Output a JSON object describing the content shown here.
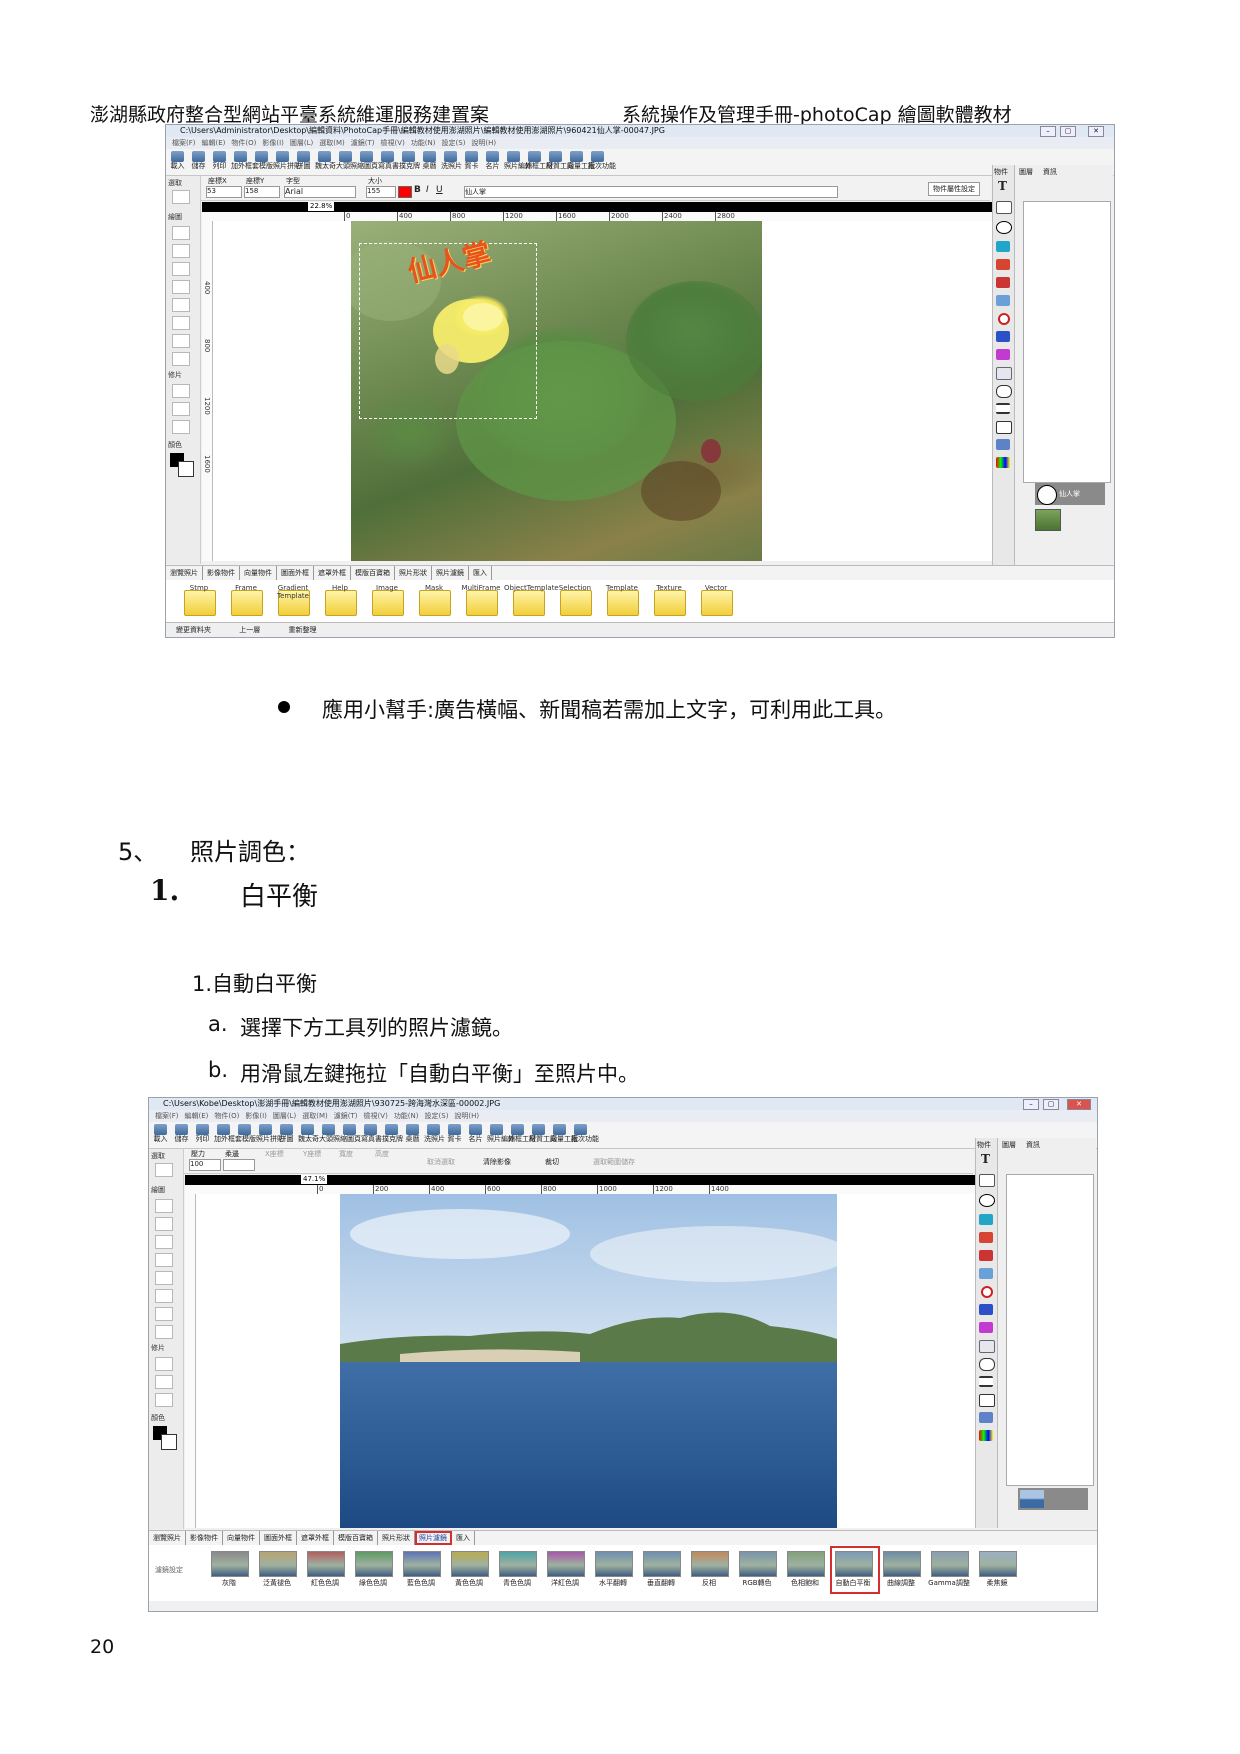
{
  "header": {
    "left": "澎湖縣政府整合型網站平臺系統維運服務建置案",
    "right": "系統操作及管理手冊-photoCap 繪圖軟體教材"
  },
  "screenshot1": {
    "title": "C:\\Users\\Administrator\\Desktop\\編輯資料\\PhotoCap手冊\\編輯教材使用澎湖照片\\編輯教材使用澎湖照片\\960421仙人掌-00047.JPG",
    "menu": [
      "檔案(F)",
      "編輯(E)",
      "物件(O)",
      "影像(I)",
      "圖層(L)",
      "選取(M)",
      "濾鏡(T)",
      "檢視(V)",
      "功能(N)",
      "設定(S)",
      "說明(H)"
    ],
    "toolbar": [
      "載入",
      "儲存",
      "列印",
      "加外框",
      "套模版",
      "照片拼貼",
      "拼圖",
      "魏太奇",
      "大頭照",
      "縮圖頁",
      "寫真書",
      "撲克牌",
      "桌曆",
      "洗照片",
      "賀卡",
      "名片",
      "照片編輯",
      "外框工廠",
      "材質工廠",
      "向量工廠",
      "批次功能"
    ],
    "props": {
      "x_label": "座標X",
      "y_label": "座標Y",
      "font_label": "字型",
      "size_label": "大小",
      "x_val": "53",
      "y_val": "158",
      "font_val": "Arial",
      "size_val": "155",
      "text_val": "仙人掌",
      "obj_btn": "物件屬性設定"
    },
    "left_labels": [
      "選取",
      "繪圖",
      "修片",
      "顏色"
    ],
    "zoom": "22.8%",
    "ruler_ticks": [
      "0",
      "400",
      "800",
      "1200",
      "1600",
      "2000",
      "2400",
      "2800"
    ],
    "vruler_ticks": [
      "400",
      "800",
      "1200",
      "1600"
    ],
    "photo_text": "仙人掌",
    "right_tabs": [
      "物件",
      "圖層",
      "資訊"
    ],
    "layer_label": "仙人掌",
    "bottom_tabs": [
      "瀏覽照片",
      "影像物件",
      "向量物件",
      "圖面外框",
      "遮罩外框",
      "模版百寶箱",
      "照片形狀",
      "照片濾鏡",
      "匯入"
    ],
    "folders": [
      "Stmp",
      "Frame",
      "Gradient Template",
      "Help",
      "Image",
      "Mask",
      "MultiFrame",
      "ObjectTemplate",
      "Selection",
      "Template",
      "Texture",
      "Vector"
    ],
    "status": [
      "變更資料夾",
      "上一層",
      "重新整理"
    ]
  },
  "bullet": "應用小幫手:廣告橫幅、新聞稿若需加上文字，可利用此工具。",
  "section": {
    "num": "5、",
    "title": "照片調色："
  },
  "subsection": {
    "num": "1.",
    "title": "白平衡"
  },
  "item": "1.自動白平衡",
  "steps": [
    {
      "label": "a.",
      "text": "選擇下方工具列的照片濾鏡。"
    },
    {
      "label": "b.",
      "text": "用滑鼠左鍵拖拉「自動白平衡」至照片中。"
    }
  ],
  "screenshot2": {
    "title": "C:\\Users\\Kobe\\Desktop\\澎湖手冊\\編輯教材使用澎湖照片\\930725-跨海灣水深區-00002.JPG",
    "menu": [
      "檔案(F)",
      "編輯(E)",
      "物件(O)",
      "影像(I)",
      "圖層(L)",
      "選取(M)",
      "濾鏡(T)",
      "檢視(V)",
      "功能(N)",
      "設定(S)",
      "說明(H)"
    ],
    "toolbar": [
      "載入",
      "儲存",
      "列印",
      "加外框",
      "套模版",
      "照片拼貼",
      "拼圖",
      "魏太奇",
      "大頭照",
      "縮圖頁",
      "寫真書",
      "撲克牌",
      "桌曆",
      "洗照片",
      "賀卡",
      "名片",
      "照片編輯",
      "外框工廠",
      "材質工廠",
      "向量工廠",
      "批次功能"
    ],
    "props": {
      "a": "壓力",
      "b": "柔邊",
      "c": "X座標",
      "d": "Y座標",
      "e": "寬度",
      "f": "高度",
      "v1": "100",
      "cancel": "取消選取",
      "clear": "清除影像",
      "crop": "裁切",
      "save_sel": "選取範圍儲存"
    },
    "left_labels": [
      "選取",
      "繪圖",
      "修片",
      "顏色"
    ],
    "zoom": "47.1%",
    "ruler_ticks": [
      "0",
      "200",
      "400",
      "600",
      "800",
      "1000",
      "1200",
      "1400"
    ],
    "right_tabs": [
      "物件",
      "圖層",
      "資訊"
    ],
    "bottom_tabs": [
      "瀏覽照片",
      "影像物件",
      "向量物件",
      "圖面外框",
      "遮罩外框",
      "模版百寶箱",
      "照片形狀",
      "照片濾鏡",
      "匯入"
    ],
    "active_tab": "照片濾鏡",
    "filter_btn": "濾鏡設定",
    "filters": [
      "灰階",
      "泛黃褪色",
      "紅色色調",
      "綠色色調",
      "藍色色調",
      "黃色色調",
      "青色色調",
      "洋紅色調",
      "水平翻轉",
      "垂直翻轉",
      "反相",
      "RGB轉色",
      "色相飽和",
      "自動白平衡",
      "曲線調整",
      "Gamma調整",
      "柔焦鏡"
    ],
    "highlight_filter": "自動白平衡"
  },
  "page_number": "20",
  "colors": {
    "highlight": "#d32f2f",
    "accent_red": "#ff0000"
  }
}
